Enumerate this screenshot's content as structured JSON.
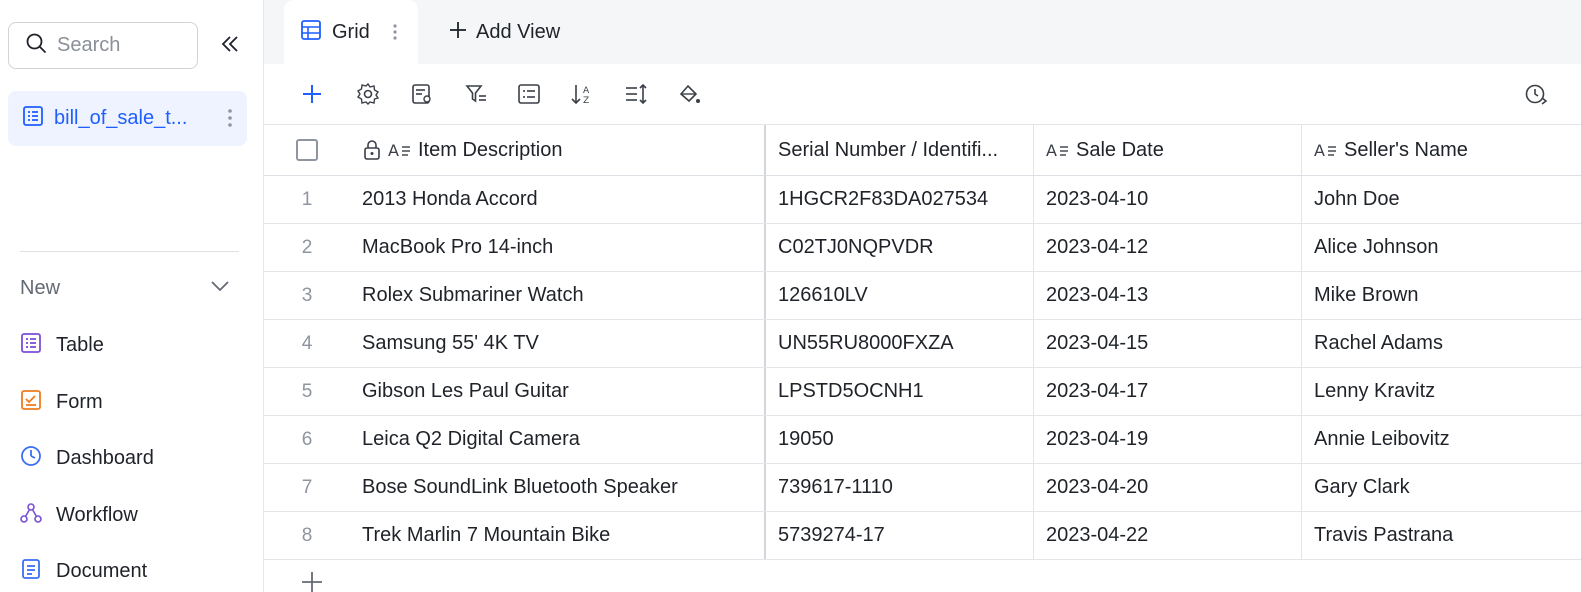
{
  "sidebar": {
    "search_placeholder": "Search",
    "active_table": "bill_of_sale_t...",
    "new_label": "New",
    "items": [
      {
        "label": "Table",
        "icon": "table-icon",
        "color": "#7b4fd6"
      },
      {
        "label": "Form",
        "icon": "form-icon",
        "color": "#f07b1c"
      },
      {
        "label": "Dashboard",
        "icon": "dashboard-icon",
        "color": "#3b6ff5"
      },
      {
        "label": "Workflow",
        "icon": "workflow-icon",
        "color": "#7b4fd6"
      },
      {
        "label": "Document",
        "icon": "document-icon",
        "color": "#3b6ff5"
      }
    ]
  },
  "tabs": {
    "grid_label": "Grid",
    "add_view_label": "Add View"
  },
  "toolbar": {
    "icons": [
      "add-icon",
      "settings-icon",
      "field-edit-icon",
      "filter-icon",
      "group-icon",
      "sort-icon",
      "row-height-icon",
      "color-fill-icon",
      "history-icon"
    ]
  },
  "table": {
    "columns": [
      "Item Description",
      "Serial Number / Identifi...",
      "Sale Date",
      "Seller's Name"
    ],
    "rows": [
      {
        "n": "1",
        "desc": "2013 Honda Accord",
        "serial": "1HGCR2F83DA027534",
        "date": "2023-04-10",
        "seller": "John Doe"
      },
      {
        "n": "2",
        "desc": "MacBook Pro 14-inch",
        "serial": "C02TJ0NQPVDR",
        "date": "2023-04-12",
        "seller": "Alice Johnson"
      },
      {
        "n": "3",
        "desc": "Rolex Submariner Watch",
        "serial": "126610LV",
        "date": "2023-04-13",
        "seller": "Mike Brown"
      },
      {
        "n": "4",
        "desc": "Samsung 55' 4K TV",
        "serial": "UN55RU8000FXZA",
        "date": "2023-04-15",
        "seller": "Rachel Adams"
      },
      {
        "n": "5",
        "desc": "Gibson Les Paul Guitar",
        "serial": "LPSTD5OCNH1",
        "date": "2023-04-17",
        "seller": "Lenny Kravitz"
      },
      {
        "n": "6",
        "desc": "Leica Q2 Digital Camera",
        "serial": "19050",
        "date": "2023-04-19",
        "seller": "Annie Leibovitz"
      },
      {
        "n": "7",
        "desc": "Bose SoundLink Bluetooth Speaker",
        "serial": "739617-1110",
        "date": "2023-04-20",
        "seller": "Gary Clark"
      },
      {
        "n": "8",
        "desc": "Trek Marlin 7 Mountain Bike",
        "serial": "5739274-17",
        "date": "2023-04-22",
        "seller": "Travis Pastrana"
      }
    ]
  },
  "colors": {
    "accent": "#1f5fff",
    "active_bg": "#eef3ff",
    "tabbar_bg": "#f5f6f7"
  }
}
